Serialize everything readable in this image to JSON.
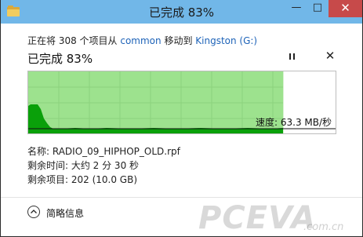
{
  "window": {
    "title": "已完成 83%"
  },
  "title_buttons": {
    "minimize": "—",
    "maximize": "□",
    "close": "✕"
  },
  "copy": {
    "prefix": "正在将 308 个项目从 ",
    "source": "common",
    "middle": " 移动到 ",
    "destination": "Kingston (G:)"
  },
  "status": {
    "heading": "已完成 83%",
    "progress_percent": 83
  },
  "controls": {
    "close_glyph": "✕"
  },
  "graph": {
    "speed_text": "速度: 63.3 MB/秒",
    "colors": {
      "fill": "#9de28e",
      "line": "#0aa00a",
      "border": "#bdbdbd"
    }
  },
  "details": {
    "name": "名称: RADIO_09_HIPHOP_OLD.rpf",
    "time_remaining": "剩余时间: 大约 2 分 30 秒",
    "items_remaining": "剩余项目: 202 (10.0 GB)"
  },
  "footer": {
    "less_details": "简略信息"
  },
  "watermark": {
    "text": "PCEVA",
    "suffix": ".com.cn"
  }
}
